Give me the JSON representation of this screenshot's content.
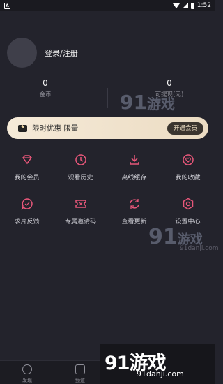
{
  "status_bar": {
    "time": "1:52",
    "app_letter": "A"
  },
  "profile": {
    "login_label": "登录/注册"
  },
  "stats": {
    "coins": {
      "value": "0",
      "label": "金币"
    },
    "cache": {
      "value": "0",
      "label": "可提现(元)"
    }
  },
  "vip_banner": {
    "text": "限时优惠 限量",
    "button": "开通会员"
  },
  "menu": [
    {
      "label": "我的会员",
      "icon": "diamond-icon"
    },
    {
      "label": "观看历史",
      "icon": "clock-icon"
    },
    {
      "label": "离线缓存",
      "icon": "download-icon"
    },
    {
      "label": "我的收藏",
      "icon": "heart-icon"
    },
    {
      "label": "求片反馈",
      "icon": "chat-icon"
    },
    {
      "label": "专属邀请码",
      "icon": "ticket-icon"
    },
    {
      "label": "查看更新",
      "icon": "refresh-icon"
    },
    {
      "label": "设置中心",
      "icon": "settings-icon"
    }
  ],
  "tabs": [
    {
      "label": "发现",
      "icon": "compass-icon"
    },
    {
      "label": "频道",
      "icon": "play-icon"
    }
  ],
  "watermark": {
    "logo": "91游戏",
    "url": "91danji.com"
  },
  "colors": {
    "accent": "#e8577a",
    "vip_gold": "#f5ead8",
    "background": "#23232c"
  }
}
